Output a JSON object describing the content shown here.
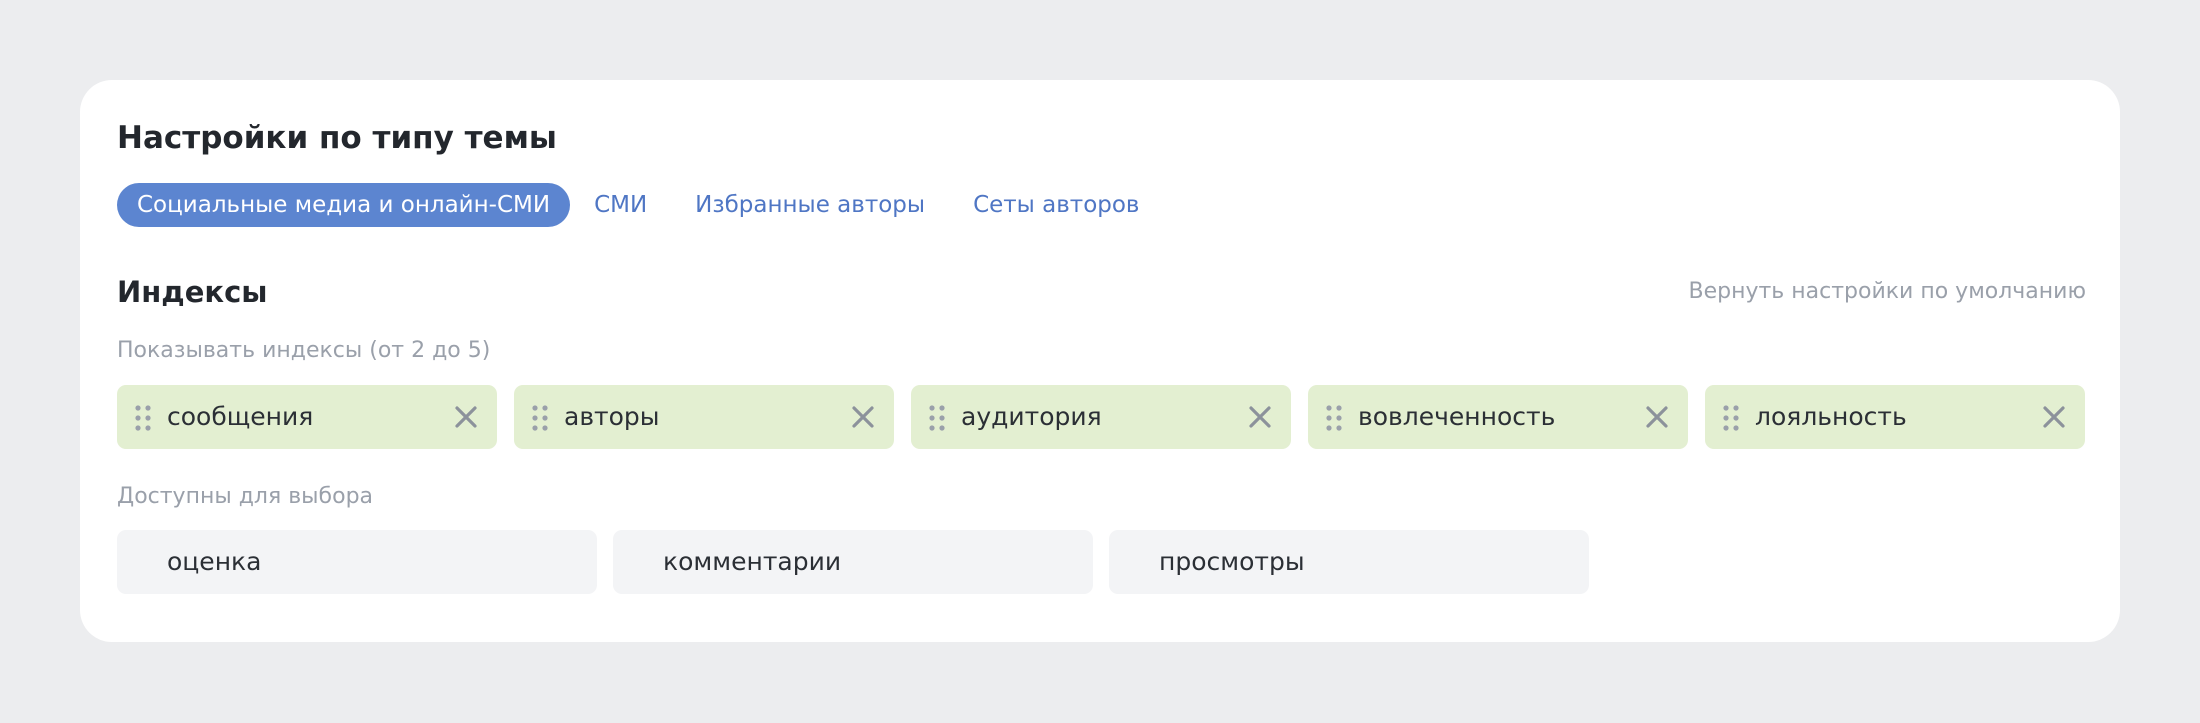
{
  "settings": {
    "title": "Настройки по типу темы",
    "tabs": [
      {
        "label": "Социальные медиа и онлайн-СМИ",
        "active": true
      },
      {
        "label": "СМИ",
        "active": false
      },
      {
        "label": "Избранные авторы",
        "active": false
      },
      {
        "label": "Сеты авторов",
        "active": false
      }
    ]
  },
  "indexes": {
    "title": "Индексы",
    "reset_label": "Вернуть настройки по умолчанию",
    "selected_label": "Показывать индексы (от 2 до 5)",
    "selected": [
      {
        "label": "сообщения"
      },
      {
        "label": "авторы"
      },
      {
        "label": "аудитория"
      },
      {
        "label": "вовлеченность"
      },
      {
        "label": "лояльность"
      }
    ],
    "available_label": "Доступны для выбора",
    "available": [
      {
        "label": "оценка"
      },
      {
        "label": "комментарии"
      },
      {
        "label": "просмотры"
      }
    ]
  },
  "icons": {
    "drag": "drag-handle-icon",
    "remove": "close-icon"
  },
  "colors": {
    "accent": "#5c85d0",
    "link": "#4f76c4",
    "selected_chip": "#e3efd1",
    "available_chip": "#f3f4f6",
    "page_background": "#ecedef"
  }
}
